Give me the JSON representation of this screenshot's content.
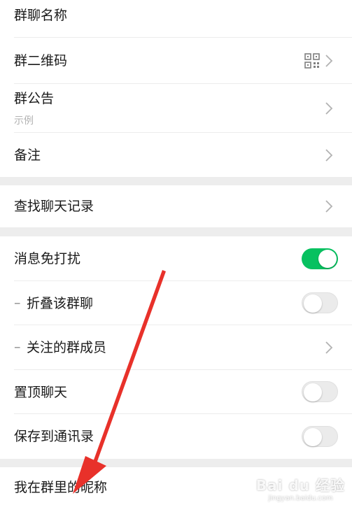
{
  "section1": {
    "group_name_label": "群聊名称",
    "qr_code_label": "群二维码",
    "announcement_label": "群公告",
    "announcement_value": "示例",
    "remark_label": "备注"
  },
  "section2": {
    "search_history_label": "查找聊天记录"
  },
  "section3": {
    "mute_label": "消息免打扰",
    "mute_on": true,
    "fold_label": "折叠该群聊",
    "fold_on": false,
    "followed_members_label": "关注的群成员",
    "pin_label": "置顶聊天",
    "pin_on": false,
    "save_contacts_label": "保存到通讯录",
    "save_contacts_on": false
  },
  "section4": {
    "my_nickname_label": "我在群里的昵称"
  },
  "watermark": {
    "brand": "Bai du 经验",
    "url": "jingyan.baidu.com"
  },
  "colors": {
    "accent_green": "#07c160",
    "annotation_arrow": "#e8312a"
  }
}
